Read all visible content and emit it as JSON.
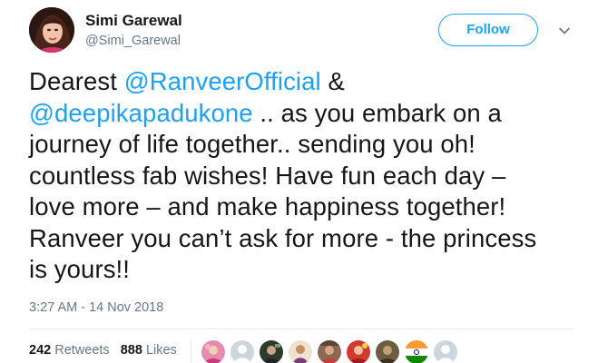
{
  "author": {
    "name": "Simi Garewal",
    "handle": "@Simi_Garewal"
  },
  "follow_label": "Follow",
  "tweet": {
    "lines": [
      [
        "Dearest ",
        "@RanveerOfficial",
        " &"
      ],
      [
        "@deepikapadukone",
        " .. as you embark on a"
      ],
      [
        "journey of life together.. sending you oh!"
      ],
      [
        "countless fab wishes! Have fun each day –"
      ],
      [
        "love more – and make happiness together!"
      ],
      [
        "Ranveer you can’t ask for more - the princess"
      ],
      [
        "is yours!!"
      ]
    ]
  },
  "timestamp": "3:27 AM - 14 Nov 2018",
  "stats": {
    "retweets_count": "242",
    "retweets_label": "Retweets",
    "likes_count": "888",
    "likes_label": "Likes"
  },
  "likers": [
    {
      "icon": "liker-avatar-pink"
    },
    {
      "icon": "liker-avatar-default"
    },
    {
      "icon": "liker-avatar-dark"
    },
    {
      "icon": "liker-avatar-tan"
    },
    {
      "icon": "liker-avatar-brown"
    },
    {
      "icon": "liker-avatar-red"
    },
    {
      "icon": "liker-avatar-olive"
    },
    {
      "icon": "liker-avatar-flag"
    },
    {
      "icon": "liker-avatar-default"
    }
  ],
  "colors": {
    "accent": "#1da1f2",
    "text": "#14171a",
    "muted": "#657786",
    "border": "#e6ecf0"
  }
}
